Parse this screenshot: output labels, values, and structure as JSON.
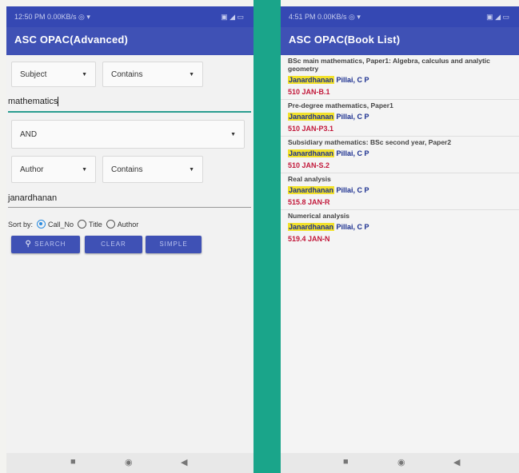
{
  "left": {
    "status": {
      "left": "12:50 PM 0.00KB/s ◎ ▾",
      "right": "▣ ◢ ▭"
    },
    "app_title": "ASC OPAC(Advanced)",
    "field1_select": "Subject",
    "op1_select": "Contains",
    "term1_value": "mathematics",
    "bool_select": "AND",
    "field2_select": "Author",
    "op2_select": "Contains",
    "term2_value": "janardhanan",
    "sort_label": "Sort by:",
    "sort_options": [
      "Call_No",
      "Title",
      "Author"
    ],
    "sort_selected": "Call_No",
    "search_button": "SEARCH",
    "clear_button": "CLEAR",
    "simple_button": "SIMPLE"
  },
  "right": {
    "status": {
      "left": "4:51 PM 0.00KB/s ◎ ▾",
      "right": "▣ ◢ ▭"
    },
    "app_title": "ASC OPAC(Book List)",
    "books": [
      {
        "title": "BSc main mathematics, Paper1: Algebra, calculus and analytic geometry",
        "author_hl": "Janardhanan",
        "author_rest": " Pillai, C P",
        "call_no": "510  JAN-B.1"
      },
      {
        "title": "Pre-degree mathematics, Paper1",
        "author_hl": "Janardhanan",
        "author_rest": " Pillai, C P",
        "call_no": "510  JAN-P3.1"
      },
      {
        "title": "Subsidiary mathematics: BSc second year, Paper2",
        "author_hl": "Janardhanan",
        "author_rest": " Pillai, C P",
        "call_no": "510  JAN-S.2"
      },
      {
        "title": "Real analysis",
        "author_hl": "Janardhanan",
        "author_rest": " Pillai, C P",
        "call_no": "515.8  JAN-R"
      },
      {
        "title": "Numerical analysis",
        "author_hl": "Janardhanan",
        "author_rest": " Pillai, C P",
        "call_no": "519.4  JAN-N"
      }
    ]
  },
  "nav": {
    "recent": "■",
    "home": "◉",
    "back": "◀"
  },
  "colors": {
    "appbar": "#3f51b5",
    "highlight": "#f2e12b",
    "call_number": "#c2183a",
    "divider": "#1aa58a"
  }
}
